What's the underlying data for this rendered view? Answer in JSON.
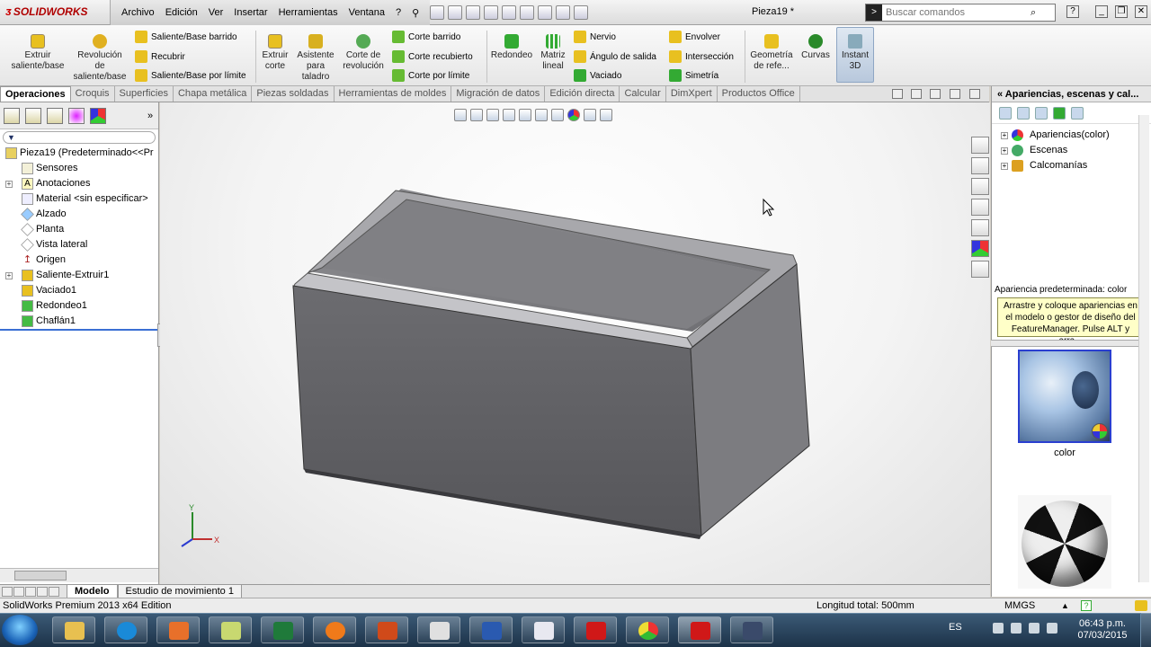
{
  "app": {
    "name": "SOLIDWORKS",
    "document": "Pieza19 *"
  },
  "menu": [
    "Archivo",
    "Edición",
    "Ver",
    "Insertar",
    "Herramientas",
    "Ventana",
    "?"
  ],
  "search": {
    "placeholder": "Buscar comandos"
  },
  "ribbon": {
    "extruir_saliente": "Extruir saliente/base",
    "revolucion_saliente": "Revolución de saliente/base",
    "saliente_barrido": "Saliente/Base barrido",
    "recubrir": "Recubrir",
    "saliente_limite": "Saliente/Base por límite",
    "extruir_corte": "Extruir corte",
    "asistente_taladro": "Asistente para taladro",
    "corte_revolucion": "Corte de revolución",
    "corte_barrido": "Corte barrido",
    "corte_recubierto": "Corte recubierto",
    "corte_limite": "Corte por límite",
    "redondeo": "Redondeo",
    "matriz_lineal": "Matriz lineal",
    "nervio": "Nervio",
    "angulo_salida": "Ángulo de salida",
    "vaciado": "Vaciado",
    "envolver": "Envolver",
    "interseccion": "Intersección",
    "simetria": "Simetría",
    "geometria_ref": "Geometría de refe...",
    "curvas": "Curvas",
    "instant3d": "Instant 3D"
  },
  "tabs": [
    "Operaciones",
    "Croquis",
    "Superficies",
    "Chapa metálica",
    "Piezas soldadas",
    "Herramientas de moldes",
    "Migración de datos",
    "Edición directa",
    "Calcular",
    "DimXpert",
    "Productos Office"
  ],
  "tree": {
    "root": "Pieza19  (Predeterminado<<Pr",
    "items": [
      "Sensores",
      "Anotaciones",
      "Material <sin especificar>",
      "Alzado",
      "Planta",
      "Vista lateral",
      "Origen",
      "Saliente-Extruir1",
      "Vaciado1",
      "Redondeo1",
      "Chaflán1"
    ]
  },
  "bottom_tabs": [
    "Modelo",
    "Estudio de movimiento 1"
  ],
  "triad": {
    "x": "X",
    "y": "Y"
  },
  "right_pane": {
    "title": "Apariencias, escenas y cal...",
    "tree": [
      "Apariencias(color)",
      "Escenas",
      "Calcomanías"
    ],
    "default_label": "Apariencia predeterminada: color",
    "tip": "Arrastre y coloque apariencias en el modelo o gestor de diseño del FeatureManager. Pulse ALT y arra...",
    "swatch1_label": "color"
  },
  "status": {
    "edition": "SolidWorks Premium 2013 x64 Edition",
    "measure": "Longitud total: 500mm",
    "units": "MMGS"
  },
  "taskbar": {
    "lang": "ES",
    "time": "06:43 p.m.",
    "date": "07/03/2015"
  }
}
